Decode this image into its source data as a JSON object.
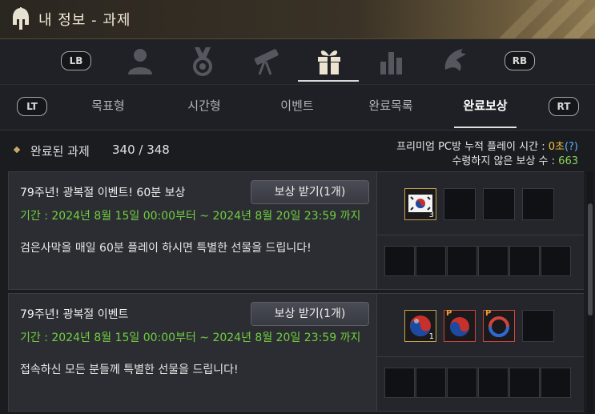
{
  "window": {
    "title": "내 정보 - 과제"
  },
  "icon_bar": {
    "lb_label": "LB",
    "rb_label": "RB",
    "icons": [
      "profile-icon",
      "medal-icon",
      "telescope-icon",
      "gift-icon",
      "stats-icon",
      "dragon-icon"
    ],
    "active_icon": "gift-icon"
  },
  "tabs": {
    "lt_label": "LT",
    "rt_label": "RT",
    "items": [
      "목표형",
      "시간형",
      "이벤트",
      "완료목록",
      "완료보상"
    ],
    "active": "완료보상"
  },
  "summary": {
    "completed_label": "완료된 과제",
    "completed_count": "340 / 348",
    "premium_label": "프리미엄 PC방 누적 플레이 시간 :",
    "premium_value": "0초",
    "premium_help": "(?)",
    "unclaimed_label": "수령하지 않은 보상 수 :",
    "unclaimed_value": "663"
  },
  "quests": [
    {
      "title": "79주년! 광복절 이벤트! 60분 보상",
      "button": "보상 받기(1개)",
      "period": "기간 : 2024년 8월 15일 00:00부터 ~ 2024년 8월 20일 23:59 까지",
      "description": "검은사막을 매일 60분 플레이 하시면 특별한 선물을 드립니다!",
      "rewards": [
        {
          "icon": "korean-flag-icon",
          "count": "3"
        }
      ]
    },
    {
      "title": "79주년! 광복절 이벤트",
      "button": "보상 받기(1개)",
      "period": "기간 : 2024년 8월 15일 00:00부터 ~ 2024년 8월 20일 23:59 까지",
      "description": "접속하신 모든 분들께 특별한 선물을 드립니다!",
      "rewards": [
        {
          "icon": "taegeuk-orb-icon",
          "count": "1"
        },
        {
          "icon": "taegeuk-orb-icon",
          "badge": "P"
        },
        {
          "icon": "taegeuk-ring-icon",
          "badge": "P"
        }
      ]
    }
  ],
  "colors": {
    "accent_gold": "#c9a44a",
    "period_green": "#6fcf3e",
    "count_green": "#8cd35c",
    "time_yellow": "#f0c040"
  }
}
